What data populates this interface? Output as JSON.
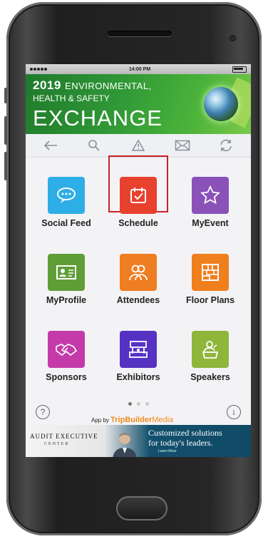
{
  "status_bar": {
    "time": "14:00 PM"
  },
  "banner": {
    "line1_year": "2019",
    "line1_rest": "ENVIRONMENTAL,",
    "line2": "HEALTH & SAFETY",
    "line3": "EXCHANGE"
  },
  "toolbar": {
    "items": [
      {
        "name": "back",
        "icon": "arrow-left-icon"
      },
      {
        "name": "search",
        "icon": "search-icon"
      },
      {
        "name": "alert",
        "icon": "warning-icon"
      },
      {
        "name": "mail",
        "icon": "mail-icon"
      },
      {
        "name": "sync",
        "icon": "refresh-icon"
      }
    ]
  },
  "tiles": [
    {
      "label": "Social Feed",
      "color": "#2eaee6",
      "icon": "chat-bubble-icon"
    },
    {
      "label": "Schedule",
      "color": "#e8412e",
      "icon": "calendar-check-icon",
      "highlighted": true
    },
    {
      "label": "MyEvent",
      "color": "#8a52b8",
      "icon": "star-icon"
    },
    {
      "label": "MyProfile",
      "color": "#5f9e36",
      "icon": "id-card-icon"
    },
    {
      "label": "Attendees",
      "color": "#ef7d22",
      "icon": "people-icon"
    },
    {
      "label": "Floor Plans",
      "color": "#f07f1e",
      "icon": "floor-plan-icon"
    },
    {
      "label": "Sponsors",
      "color": "#c43aa8",
      "icon": "handshake-icon"
    },
    {
      "label": "Exhibitors",
      "color": "#5532c2",
      "icon": "booth-icon"
    },
    {
      "label": "Speakers",
      "color": "#8fb53a",
      "icon": "speaker-podium-icon"
    }
  ],
  "pager": {
    "pages": 3,
    "current": 1
  },
  "footer": {
    "help_glyph": "?",
    "info_glyph": "i",
    "app_by": "App by",
    "brand_a": "TripBuilder",
    "brand_b": "Media"
  },
  "ad": {
    "title": "AUDIT EXECUTIVE",
    "subtitle": "CENTER",
    "line1": "Customized solutions",
    "line2": "for today's leaders.",
    "cta": "Learn More"
  }
}
